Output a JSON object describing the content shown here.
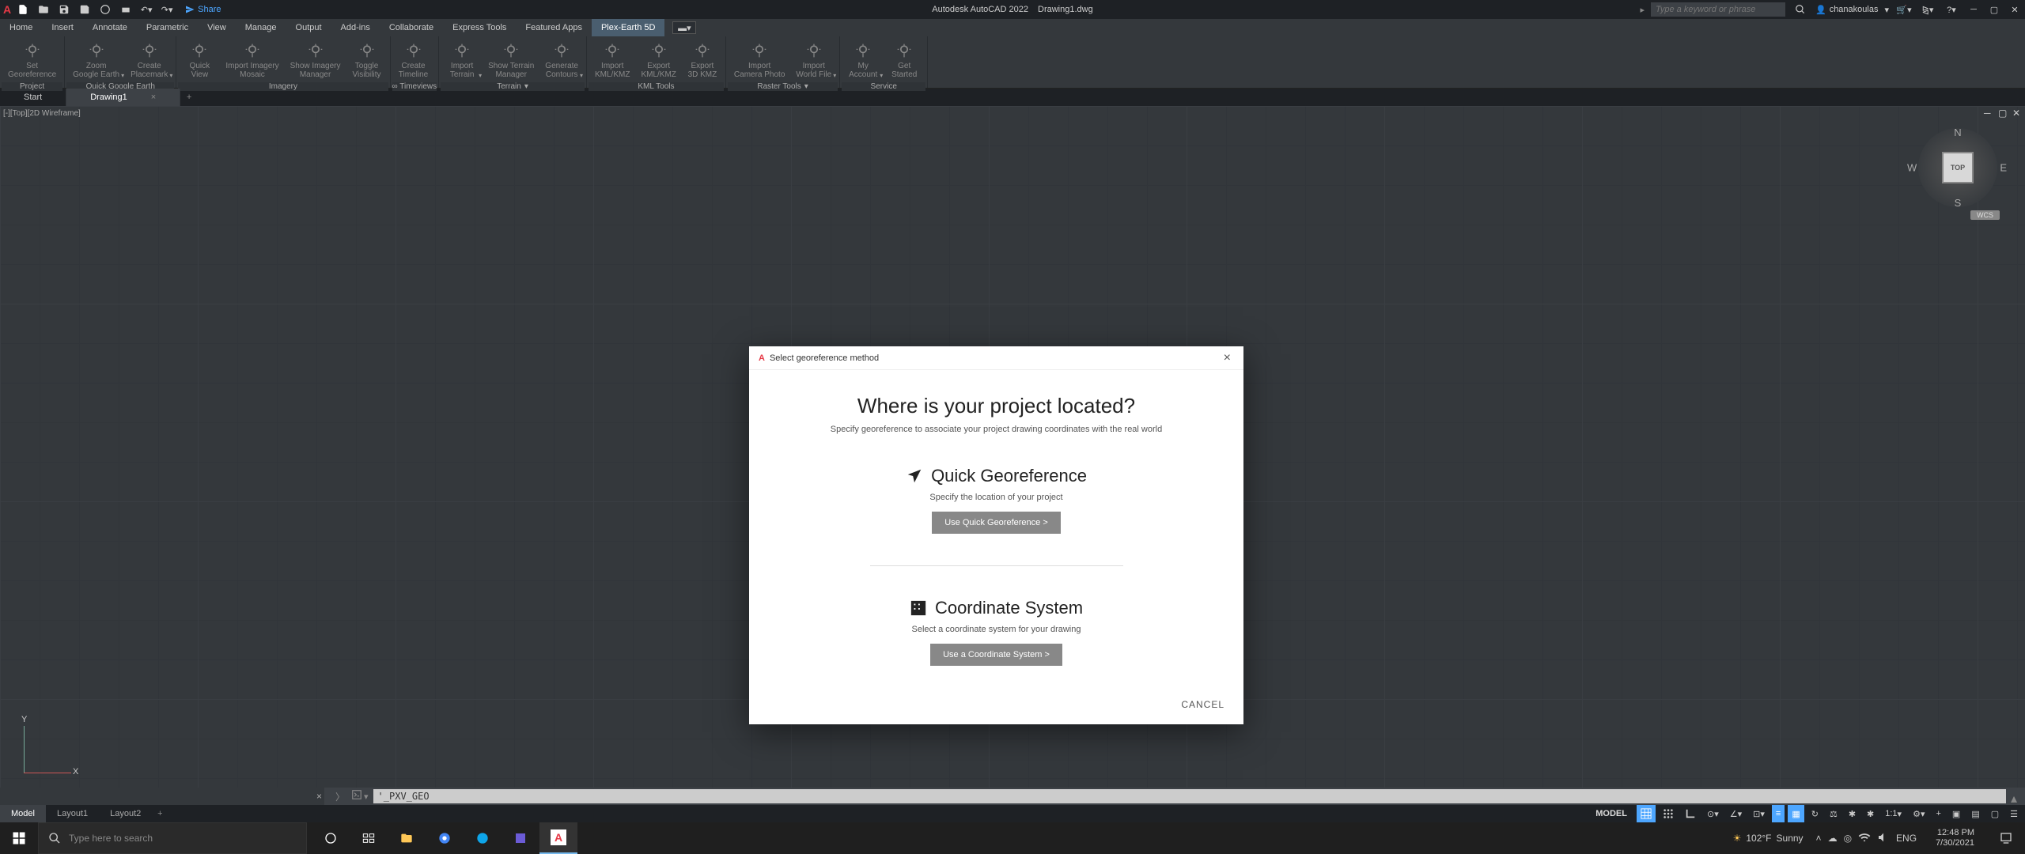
{
  "titlebar": {
    "share": "Share",
    "app_name": "Autodesk AutoCAD 2022",
    "doc_name": "Drawing1.dwg",
    "search_placeholder": "Type a keyword or phrase",
    "username": "chanakoulas"
  },
  "menubar": {
    "items": [
      "Home",
      "Insert",
      "Annotate",
      "Parametric",
      "View",
      "Manage",
      "Output",
      "Add-ins",
      "Collaborate",
      "Express Tools",
      "Featured Apps",
      "Plex-Earth 5D"
    ]
  },
  "ribbon": {
    "groups": [
      {
        "label": "Project",
        "dropdown": false,
        "tools": [
          {
            "label": "Set\nGeoreference",
            "dd": false
          }
        ]
      },
      {
        "label": "Quick Google Earth",
        "dropdown": false,
        "tools": [
          {
            "label": "Zoom\nGoogle Earth",
            "dd": true
          },
          {
            "label": "Create\nPlacemark",
            "dd": true
          }
        ]
      },
      {
        "label": "Imagery",
        "dropdown": false,
        "tools": [
          {
            "label": "Quick\nView",
            "dd": false
          },
          {
            "label": "Import Imagery\nMosaic",
            "dd": false
          },
          {
            "label": "Show Imagery\nManager",
            "dd": false
          },
          {
            "label": "Toggle\nVisibility",
            "dd": false
          }
        ]
      },
      {
        "label": "∞ Timeviews",
        "dropdown": false,
        "tools": [
          {
            "label": "Create\nTimeline",
            "dd": false
          }
        ]
      },
      {
        "label": "Terrain",
        "dropdown": true,
        "tools": [
          {
            "label": "Import\nTerrain",
            "dd": true
          },
          {
            "label": "Show Terrain\nManager",
            "dd": false
          },
          {
            "label": "Generate\nContours",
            "dd": true
          }
        ]
      },
      {
        "label": "KML Tools",
        "dropdown": false,
        "tools": [
          {
            "label": "Import\nKML/KMZ",
            "dd": false
          },
          {
            "label": "Export\nKML/KMZ",
            "dd": false
          },
          {
            "label": "Export\n3D KMZ",
            "dd": false
          }
        ]
      },
      {
        "label": "Raster Tools",
        "dropdown": true,
        "tools": [
          {
            "label": "Import\nCamera Photo",
            "dd": false
          },
          {
            "label": "Import\nWorld File",
            "dd": true
          }
        ]
      },
      {
        "label": "Service",
        "dropdown": false,
        "tools": [
          {
            "label": "My\nAccount",
            "dd": true
          },
          {
            "label": "Get\nStarted",
            "dd": false
          }
        ]
      }
    ]
  },
  "doc_tabs": {
    "items": [
      {
        "name": "Start",
        "active": false
      },
      {
        "name": "Drawing1",
        "active": true
      }
    ]
  },
  "viewport": {
    "label": "[-][Top][2D Wireframe]",
    "viewcube_top": "TOP",
    "wcs": "WCS",
    "ucs_y": "Y",
    "ucs_x": "X"
  },
  "dialog": {
    "title": "Select georeference method",
    "heading": "Where is your project located?",
    "subheading": "Specify georeference to associate your project drawing coordinates with the real world",
    "quick": {
      "heading": "Quick Georeference",
      "desc": "Specify the location of your project",
      "button": "Use Quick Georeference >"
    },
    "coord": {
      "heading": "Coordinate System",
      "desc": "Select a coordinate system for your drawing",
      "button": "Use a Coordinate System >"
    },
    "cancel": "CANCEL"
  },
  "command": {
    "value": "'_PXV_GEO"
  },
  "statusbar": {
    "tabs": [
      {
        "name": "Model",
        "active": true
      },
      {
        "name": "Layout1",
        "active": false
      },
      {
        "name": "Layout2",
        "active": false
      }
    ],
    "model_label": "MODEL",
    "scale_label": "1:1"
  },
  "taskbar": {
    "search_placeholder": "Type here to search",
    "weather_temp": "102°F",
    "weather_cond": "Sunny",
    "lang": "ENG",
    "time": "12:48 PM",
    "date": "7/30/2021"
  }
}
